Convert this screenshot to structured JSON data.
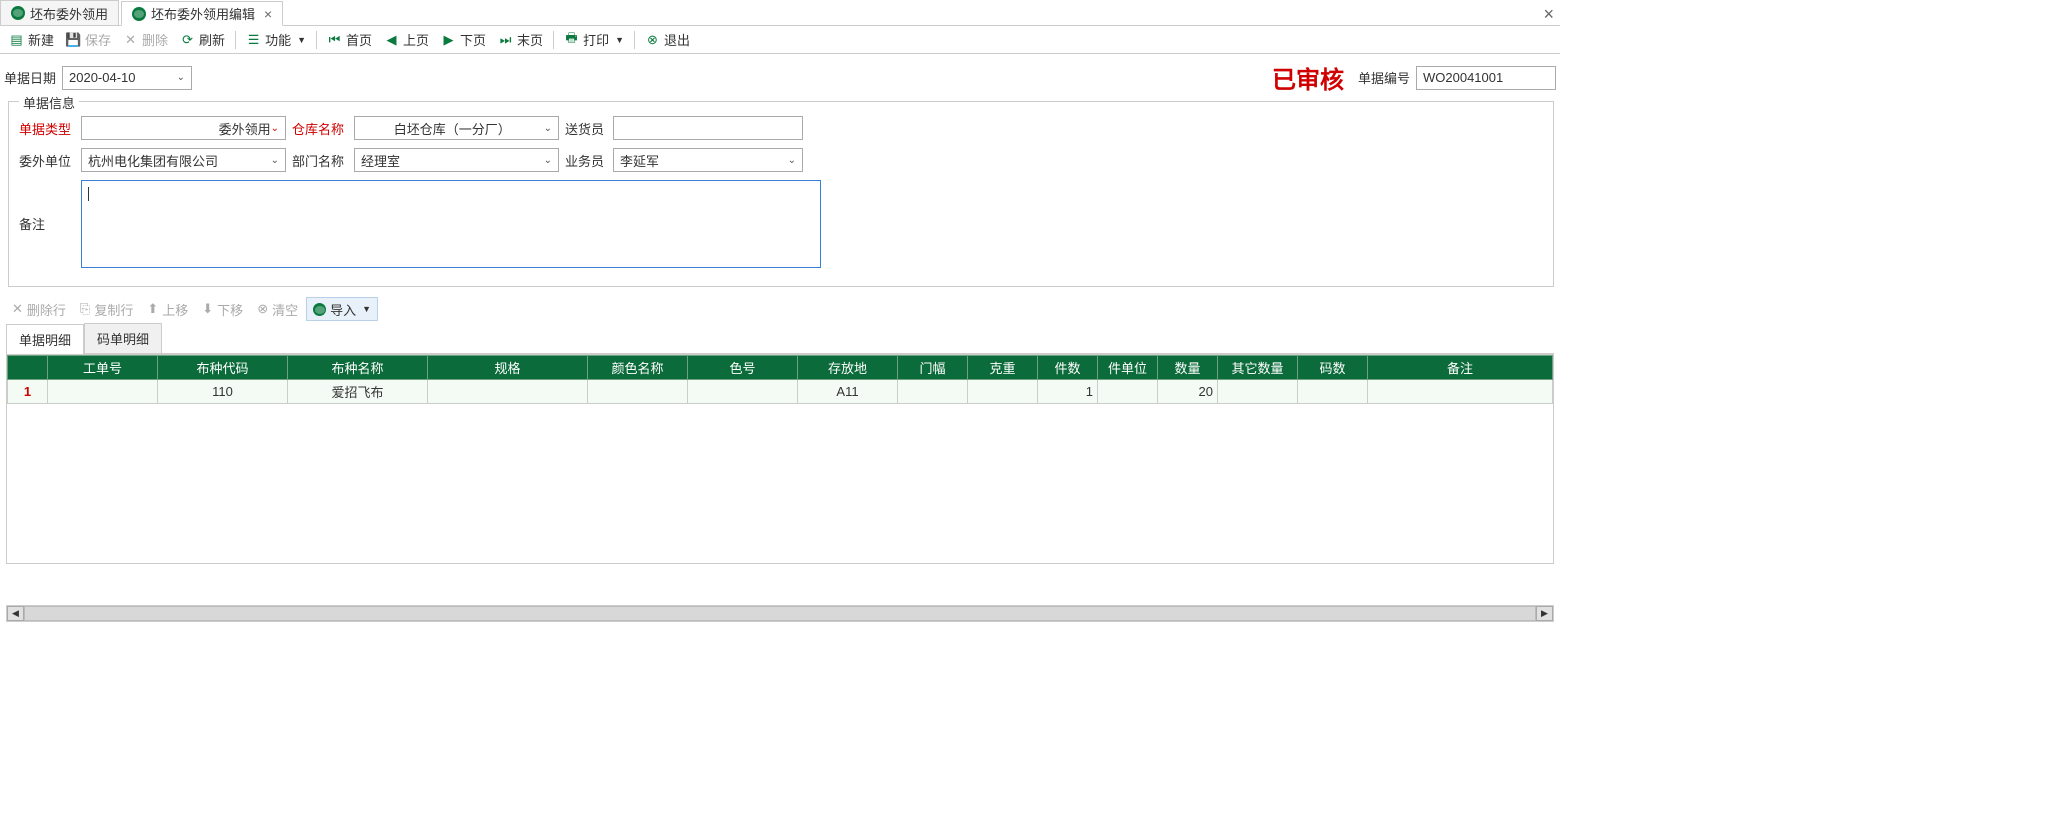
{
  "tabs": {
    "t0": "坯布委外领用",
    "t1": "坯布委外领用编辑"
  },
  "toolbar": {
    "new": "新建",
    "save": "保存",
    "delete": "删除",
    "refresh": "刷新",
    "func": "功能",
    "first": "首页",
    "prev": "上页",
    "next": "下页",
    "last": "末页",
    "print": "打印",
    "exit": "退出"
  },
  "top": {
    "date_label": "单据日期",
    "date_value": "2020-04-10",
    "audited": "已审核",
    "docno_label": "单据编号",
    "docno_value": "WO20041001"
  },
  "fs": {
    "legend": "单据信息",
    "type_label": "单据类型",
    "type_value": "委外领用",
    "wh_label": "仓库名称",
    "wh_value": "白坯仓库（一分厂）",
    "sender_label": "送货员",
    "sender_value": "",
    "outunit_label": "委外单位",
    "outunit_value": "杭州电化集团有限公司",
    "dept_label": "部门名称",
    "dept_value": "经理室",
    "biz_label": "业务员",
    "biz_value": "李延军",
    "remark_label": "备注",
    "remark_value": ""
  },
  "rowbar": {
    "delrow": "删除行",
    "copyrow": "复制行",
    "moveup": "上移",
    "movedown": "下移",
    "clear": "清空",
    "import": "导入"
  },
  "dtabs": {
    "t0": "单据明细",
    "t1": "码单明细"
  },
  "grid": {
    "headers": {
      "workno": "工单号",
      "code": "布种代码",
      "name": "布种名称",
      "spec": "规格",
      "colorname": "颜色名称",
      "colorno": "色号",
      "loc": "存放地",
      "width": "门幅",
      "gweight": "克重",
      "pcs": "件数",
      "pcsunit": "件单位",
      "qty": "数量",
      "otherqty": "其它数量",
      "yard": "码数",
      "remark": "备注"
    },
    "rows": [
      {
        "idx": "1",
        "workno": "",
        "code": "110",
        "name": "爱招飞布",
        "spec": "",
        "colorname": "",
        "colorno": "",
        "loc": "A11",
        "width": "",
        "gweight": "",
        "pcs": "1",
        "pcsunit": "",
        "qty": "20",
        "otherqty": "",
        "yard": "",
        "remark": ""
      }
    ]
  }
}
